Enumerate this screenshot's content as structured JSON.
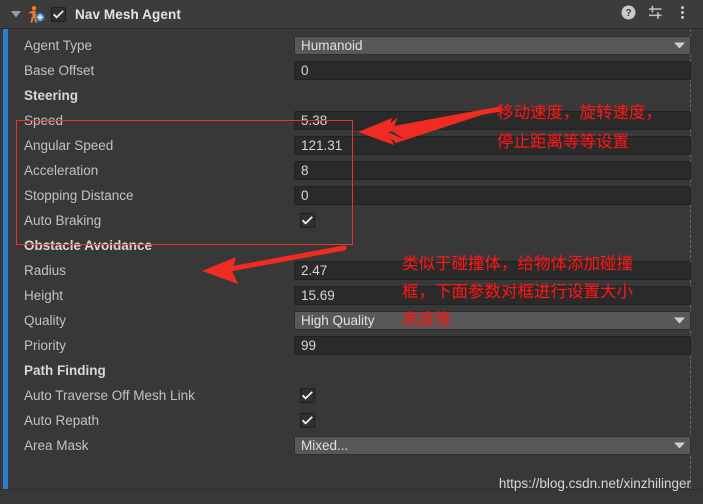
{
  "window": {
    "background_color": "#383838",
    "selection_strip_color": "#2c7fd0"
  },
  "header": {
    "title": "Nav Mesh Agent",
    "foldout_icon": "triangle-down-icon",
    "component_icon": "nav-mesh-agent-icon",
    "enabled_checkbox": true,
    "buttons": [
      {
        "name": "help-icon",
        "label": "?"
      },
      {
        "name": "preset-icon",
        "label": ""
      },
      {
        "name": "more-menu-icon",
        "label": ""
      }
    ]
  },
  "inspector": {
    "rows": [
      {
        "label": "Agent Type",
        "type": "dropdown",
        "value": "Humanoid"
      },
      {
        "label": "Base Offset",
        "type": "number",
        "value": "0"
      },
      {
        "label": "Steering",
        "type": "section"
      },
      {
        "label": "Speed",
        "type": "number",
        "value": "5.38"
      },
      {
        "label": "Angular Speed",
        "type": "number",
        "value": "121.31"
      },
      {
        "label": "Acceleration",
        "type": "number",
        "value": "8"
      },
      {
        "label": "Stopping Distance",
        "type": "number",
        "value": "0"
      },
      {
        "label": "Auto Braking",
        "type": "checkbox",
        "value": true
      },
      {
        "label": "Obstacle Avoidance",
        "type": "section"
      },
      {
        "label": "Radius",
        "type": "number",
        "value": "2.47"
      },
      {
        "label": "Height",
        "type": "number",
        "value": "15.69"
      },
      {
        "label": "Quality",
        "type": "dropdown",
        "value": "High Quality"
      },
      {
        "label": "Priority",
        "type": "number",
        "value": "99"
      },
      {
        "label": "Path Finding",
        "type": "section"
      },
      {
        "label": "Auto Traverse Off Mesh Link",
        "type": "checkbox",
        "value": true
      },
      {
        "label": "Auto Repath",
        "type": "checkbox",
        "value": true
      },
      {
        "label": "Area Mask",
        "type": "dropdown",
        "value": "Mixed..."
      }
    ]
  },
  "annotations": {
    "color": "#ef1d1d",
    "texts": [
      {
        "name": "annotation-steering-line1",
        "text": "移动速度，旋转速度，"
      },
      {
        "name": "annotation-steering-line2",
        "text": "停止距离等等设置"
      },
      {
        "name": "annotation-avoidance-line1",
        "text": "类似于碰撞体，给物体添加碰撞"
      },
      {
        "name": "annotation-avoidance-line2",
        "text": "框，下面参数对框进行设置大小"
      },
      {
        "name": "annotation-avoidance-line3",
        "text": "高度等"
      }
    ]
  },
  "watermark": {
    "text": "https://blog.csdn.net/xinzhilinger"
  }
}
